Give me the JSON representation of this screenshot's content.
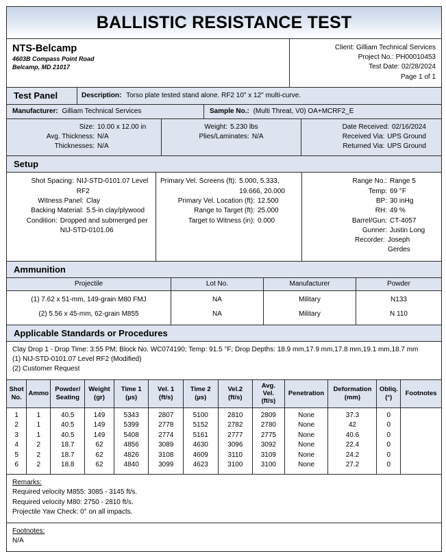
{
  "document": {
    "title": "BALLISTIC RESISTANCE TEST"
  },
  "lab": {
    "name": "NTS-Belcamp",
    "address_line1": "4603B Compass Point Road",
    "address_line2": "Belcamp, MD 21017"
  },
  "client_info": {
    "client": "Client: Gilliam Technical Services",
    "project_no": "Project No.: PH00010453",
    "test_date": "Test Date: 02/28/2024",
    "page": "Page 1 of 1"
  },
  "test_panel": {
    "section_label": "Test Panel",
    "description_label": "Description:",
    "description_value": "Torso plate tested stand alone. RF2 10\" x 12\" multi-curve.",
    "manufacturer_label": "Manufacturer:",
    "manufacturer_value": "Gilliam Technical Services",
    "sample_no_label": "Sample No.:",
    "sample_no_value": "(Multi Threat, V0) OA+MCRF2_E",
    "size_label": "Size:",
    "size_value": "10.00 x 12.00 in",
    "avg_thickness_label": "Avg. Thickness:",
    "avg_thickness_value": "N/A",
    "thicknesses_label": "Thicknesses:",
    "thicknesses_value": "N/A",
    "weight_label": "Weight:",
    "weight_value": "5.230 lbs",
    "plies_label": "Plies/Laminates:",
    "plies_value": "N/A",
    "date_received_label": "Date Received:",
    "date_received_value": "02/16/2024",
    "received_via_label": "Received Via:",
    "received_via_value": "UPS Ground",
    "returned_via_label": "Returned Via:",
    "returned_via_value": "UPS Ground"
  },
  "setup": {
    "section_label": "Setup",
    "col1": [
      {
        "key": "Shot Spacing:",
        "value": "NIJ-STD-0101.07 Level RF2"
      },
      {
        "key": "Witness Panel:",
        "value": "Clay"
      },
      {
        "key": "Backing Material:",
        "value": "5.5-in clay/plywood"
      },
      {
        "key": "Condition:",
        "value": "Dropped and submerged per NIJ-STD-0101.06"
      }
    ],
    "col2": [
      {
        "key": "Primary Vel. Screens (ft):",
        "value": "5.000, 5.333, 19.666, 20.000"
      },
      {
        "key": "Primary Vel. Location (ft):",
        "value": "12.500"
      },
      {
        "key": "Range to Target (ft):",
        "value": "25.000"
      },
      {
        "key": "Target to Witness (in):",
        "value": "0.000"
      }
    ],
    "col3": [
      {
        "key": "Range No.:",
        "value": "Range 5"
      },
      {
        "key": "Temp:",
        "value": "69 °F"
      },
      {
        "key": "BP:",
        "value": "30 inHg"
      },
      {
        "key": "RH:",
        "value": "49 %"
      },
      {
        "key": "Barrel/Gun:",
        "value": "CT-4057"
      },
      {
        "key": "Gunner:",
        "value": "Justin Long"
      },
      {
        "key": "Recorder:",
        "value": "Joseph Gerdes"
      }
    ]
  },
  "ammunition": {
    "section_label": "Ammunition",
    "headers": [
      "Projectile",
      "Lot No.",
      "Manufacturer",
      "Powder"
    ],
    "rows": [
      [
        "(1) 7.62 x 51-mm, 149-grain M80 FMJ",
        "NA",
        "Military",
        "N133"
      ],
      [
        "(2) 5.56 x 45-mm, 62-grain M855",
        "NA",
        "Military",
        "N 110"
      ]
    ]
  },
  "standards": {
    "section_label": "Applicable Standards or Procedures",
    "lines": [
      "Clay Drop 1 - Drop Time: 3:55 PM; Block No. WC074190; Temp: 91.5 °F; Drop Depths: 18.9 mm,17.9 mm,17.8 mm,19.1 mm,18.7 mm",
      "(1) NIJ-STD-0101.07 Level RF2 (Modified)",
      "(2) Customer Request"
    ]
  },
  "shot_table": {
    "headers": [
      "Shot\nNo.",
      "Ammo",
      "Powder/\nSeating",
      "Weight\n(gr)",
      "Time 1\n(µs)",
      "Vel. 1\n(ft/s)",
      "Time 2\n(µs)",
      "Vel.2\n(ft/s)",
      "Avg.\nVel.\n(ft/s)",
      "Penetration",
      "Deformation\n(mm)",
      "Obliq.\n(°)",
      "Footnotes"
    ],
    "rows": [
      [
        "1",
        "1",
        "40.5",
        "149",
        "5343",
        "2807",
        "5100",
        "2810",
        "2809",
        "None",
        "37.3",
        "0",
        ""
      ],
      [
        "2",
        "1",
        "40.5",
        "149",
        "5399",
        "2778",
        "5152",
        "2782",
        "2780",
        "None",
        "42",
        "0",
        ""
      ],
      [
        "3",
        "1",
        "40.5",
        "149",
        "5408",
        "2774",
        "5161",
        "2777",
        "2775",
        "None",
        "40.6",
        "0",
        ""
      ],
      [
        "4",
        "2",
        "18.7",
        "62",
        "4856",
        "3089",
        "4630",
        "3096",
        "3092",
        "None",
        "22.4",
        "0",
        ""
      ],
      [
        "5",
        "2",
        "18.7",
        "62",
        "4826",
        "3108",
        "4609",
        "3110",
        "3109",
        "None",
        "24.2",
        "0",
        ""
      ],
      [
        "6",
        "2",
        "18.8",
        "62",
        "4840",
        "3099",
        "4623",
        "3100",
        "3100",
        "None",
        "27.2",
        "0",
        ""
      ]
    ]
  },
  "remarks": {
    "label": "Remarks:",
    "lines": [
      "Required velocity M855: 3085 - 3145 ft/s.",
      "Required velocity M80: 2750 - 2810 ft/s.",
      "Projectile Yaw Check: 0° on all impacts."
    ]
  },
  "footnotes": {
    "label": "Footnotes:",
    "lines": [
      "N/A"
    ]
  },
  "colors": {
    "section_header_bg": "#dde4ef",
    "banner_top": "#c9d5e8",
    "border": "#2a2a2a"
  }
}
